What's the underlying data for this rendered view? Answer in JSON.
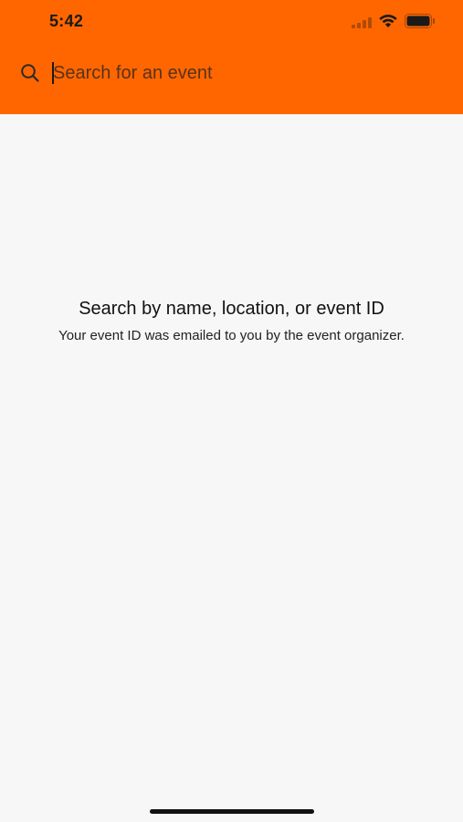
{
  "status_bar": {
    "time": "5:42",
    "icons": [
      "signal-icon",
      "wifi-icon",
      "battery-icon"
    ]
  },
  "header": {
    "background_color": "#ff6600"
  },
  "search": {
    "icon": "search-icon",
    "placeholder": "Search for an event",
    "value": ""
  },
  "empty_state": {
    "title": "Search by name, location, or event ID",
    "subtitle": "Your event ID was emailed to you by the event organizer."
  }
}
